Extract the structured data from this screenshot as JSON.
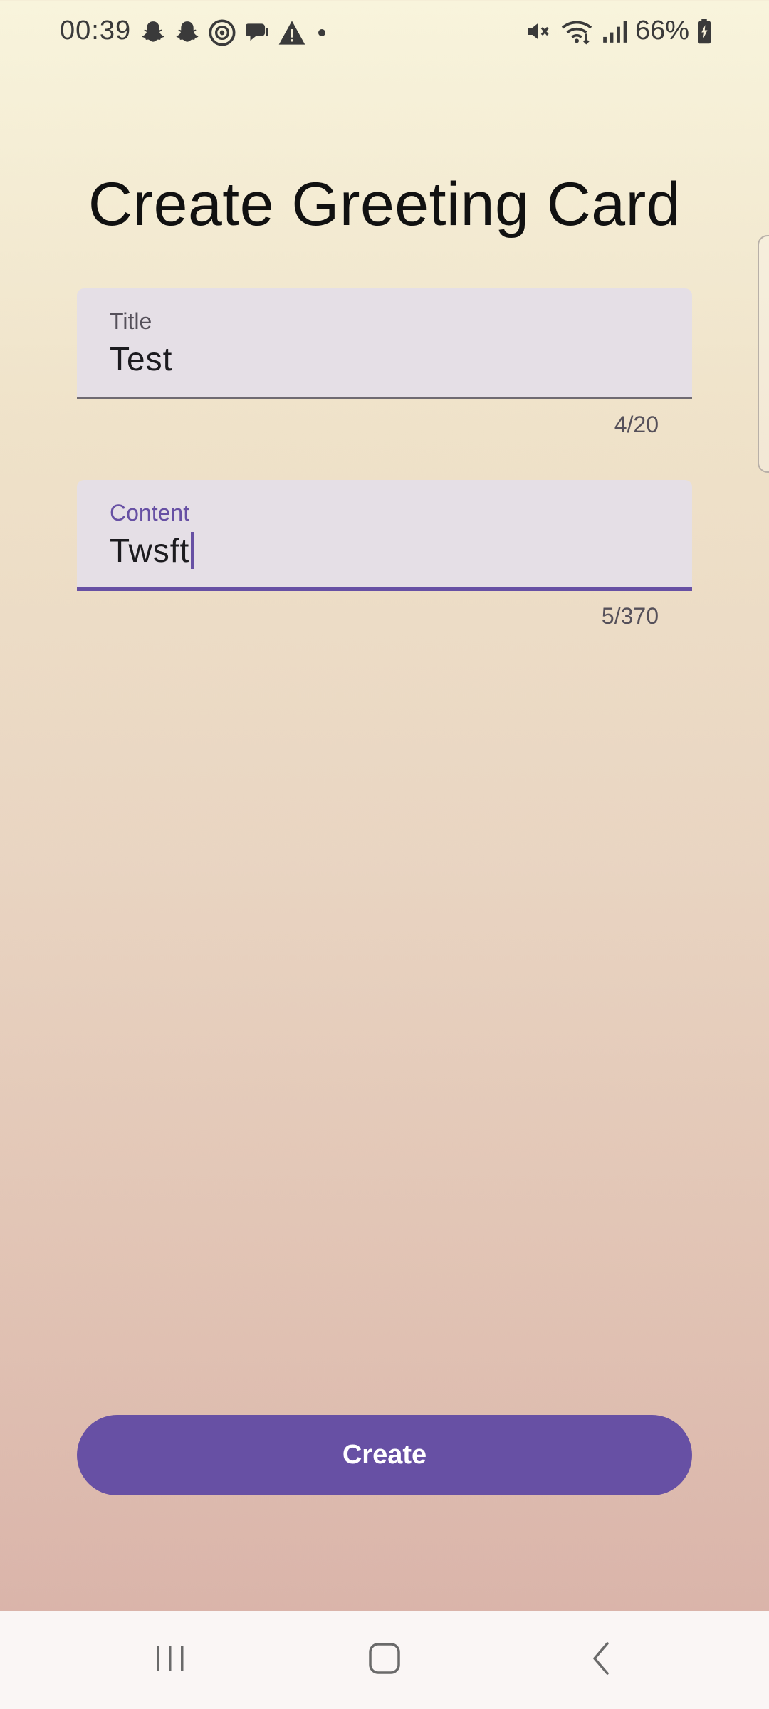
{
  "status_bar": {
    "time": "00:39",
    "notification_icons": [
      "snapchat-icon",
      "snapchat-icon",
      "threads-icon",
      "chat-bubble-icon",
      "warning-icon",
      "dot-icon"
    ],
    "right_icons": [
      "mute-icon",
      "wifi-icon",
      "signal-icon",
      "battery-icon"
    ],
    "battery_percent": "66%"
  },
  "page": {
    "title": "Create Greeting Card"
  },
  "form": {
    "title_field": {
      "label": "Title",
      "value": "Test",
      "counter": "4/20"
    },
    "content_field": {
      "label": "Content",
      "value": "Twsft",
      "counter": "5/370",
      "focused": true
    },
    "create_label": "Create"
  },
  "colors": {
    "accent": "#6750a4",
    "field_background": "#e5dfe6",
    "background_top": "#f8f4dc",
    "background_bottom": "#d8b0a7"
  },
  "nav_bar": {
    "buttons": [
      "recents-icon",
      "home-icon",
      "back-icon"
    ]
  }
}
